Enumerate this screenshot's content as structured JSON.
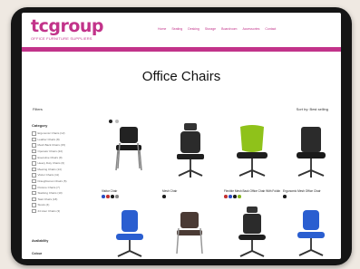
{
  "brand": {
    "name": "tcgroup",
    "tagline": "OFFICE FURNITURE SUPPLIERS"
  },
  "nav": {
    "items": [
      "Home",
      "Seating",
      "Desking",
      "Storage",
      "Boardroom",
      "Accessories",
      "Contact"
    ]
  },
  "page": {
    "title": "Office Chairs"
  },
  "toolbar": {
    "filters": "Filters",
    "sort": "Sort by: Best selling"
  },
  "sidebar": {
    "category_title": "Category",
    "categories": [
      "Ergonomic Chairs (12)",
      "Leather Chairs (8)",
      "Mesh Back Chairs (15)",
      "Operator Chairs (22)",
      "Executive Chairs (9)",
      "Heavy Duty Chairs (6)",
      "Meeting Chairs (14)",
      "Visitor Chairs (11)",
      "Draughtsman Chairs (5)",
      "Posture Chairs (7)",
      "Stacking Chairs (10)",
      "Task Chairs (18)",
      "Stools (4)",
      "24 Hour Chairs (3)"
    ],
    "availability_title": "Availability",
    "colour_title": "Colour"
  },
  "products": [
    {
      "name": "Visitor Chair",
      "swatches": [
        "#2a4ec2",
        "#c23030",
        "#1a1a1a",
        "#888888"
      ]
    },
    {
      "name": "Mesh Chair",
      "swatches": [
        "#1a1a1a"
      ]
    },
    {
      "name": "Flexible Mesh Back Office Chair With Folding Arms",
      "swatches": [
        "#c23030",
        "#2a4ec2",
        "#1a1a1a",
        "#88b820"
      ]
    },
    {
      "name": "Ergonomic Mesh Office Chair",
      "swatches": [
        "#1a1a1a"
      ]
    },
    {
      "name": "",
      "swatches": []
    },
    {
      "name": "",
      "swatches": []
    },
    {
      "name": "",
      "swatches": []
    },
    {
      "name": "",
      "swatches": []
    }
  ],
  "colors": {
    "brand": "#c2338a",
    "page_bg": "#efe9e2",
    "device_frame": "#151515"
  }
}
